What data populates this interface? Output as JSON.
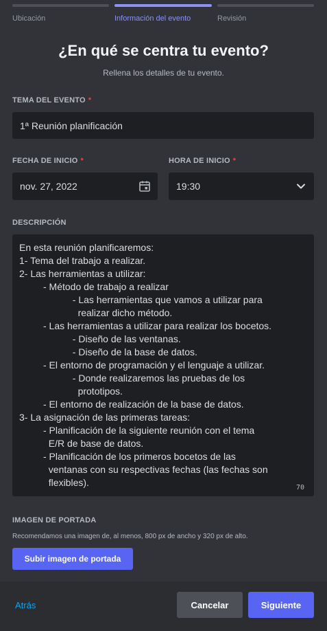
{
  "steps": [
    {
      "label": "Ubicación"
    },
    {
      "label": "Información del evento"
    },
    {
      "label": "Revisión"
    }
  ],
  "header": {
    "title": "¿En qué se centra tu evento?",
    "subtitle": "Rellena los detalles de tu evento."
  },
  "topic": {
    "label": "TEMA DEL EVENTO",
    "required": "*",
    "value": "1ª Reunión planificación"
  },
  "start_date": {
    "label": "FECHA DE INICIO",
    "required": "*",
    "value": "nov. 27, 2022"
  },
  "start_time": {
    "label": "HORA DE INICIO",
    "required": "*",
    "value": "19:30"
  },
  "description": {
    "label": "DESCRIPCIÓN",
    "lines": [
      "En esta reunión planificaremos:",
      "1- Tema del trabajo a realizar.",
      "2- Las herramientas a utilizar:",
      "         - Método de trabajo a realizar",
      "                    - Las herramientas que vamos a utilizar para",
      "                      realizar dicho método.",
      "         - Las herramientas a utilizar para realizar los bocetos.",
      "                    - Diseño de las ventanas.",
      "                    - Diseño de la base de datos.",
      "         - El entorno de programación y el lenguaje a utilizar.",
      "                    - Donde realizaremos las pruebas de los",
      "                      prototipos.",
      "         - El entorno de realización de la base de datos.",
      "3- La asignación de las primeras tareas:",
      "         - Planificación de la siguiente reunión con el tema",
      "           E/R de base de datos.",
      "         - Planificación de los primeros bocetos de las",
      "           ventanas con su respectivas fechas (las fechas son",
      "           flexibles)."
    ],
    "counter": "70"
  },
  "cover": {
    "label": "IMAGEN DE PORTADA",
    "note": "Recomendamos una imagen de, al menos, 800 px de ancho y 320 px de alto.",
    "button": "Subir imagen de portada"
  },
  "footer": {
    "back": "Atrás",
    "cancel": "Cancelar",
    "next": "Siguiente"
  },
  "icons": {
    "date": "calendar-icon",
    "time": "chevron-down-icon"
  },
  "colors": {
    "accent": "#5865f2",
    "active_step": "#8c92f4",
    "required": "#f23f43",
    "link": "#00a8fc"
  }
}
